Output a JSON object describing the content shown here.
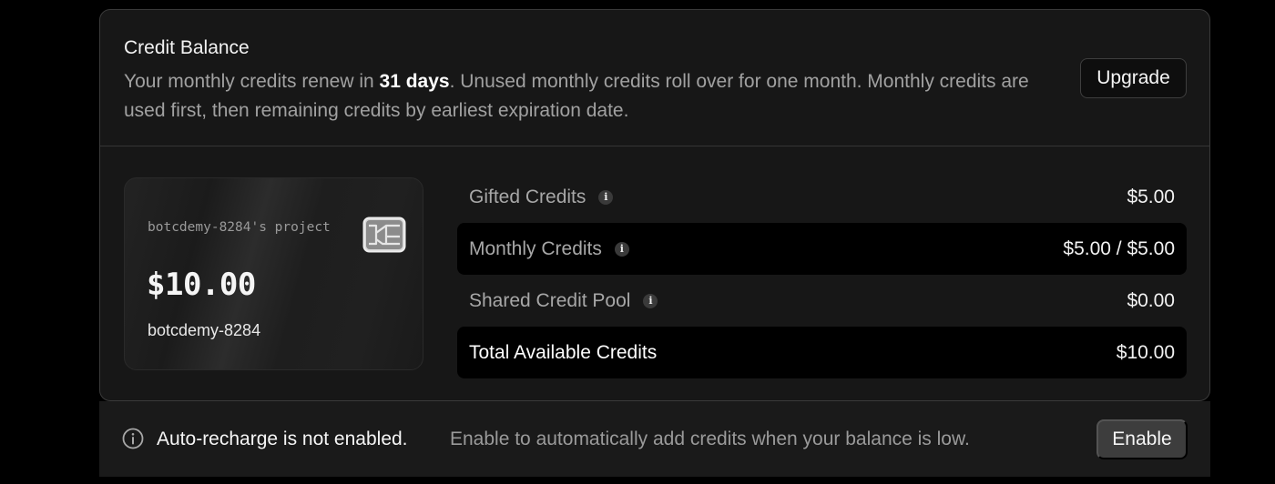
{
  "credit_balance": {
    "title": "Credit Balance",
    "desc_prefix": "Your monthly credits renew in ",
    "desc_days": "31 days",
    "desc_suffix": ". Unused monthly credits roll over for one month. Monthly credits are used first, then remaining credits by earliest expiration date.",
    "upgrade_label": "Upgrade"
  },
  "card": {
    "project": "botcdemy-8284's project",
    "amount": "$10.00",
    "name": "botcdemy-8284",
    "icon": "chip-icon"
  },
  "rows": [
    {
      "label": "Gifted Credits",
      "value": "$5.00",
      "info": true,
      "highlight": false
    },
    {
      "label": "Monthly Credits",
      "value": "$5.00 / $5.00",
      "info": true,
      "highlight": true
    },
    {
      "label": "Shared Credit Pool",
      "value": "$0.00",
      "info": true,
      "highlight": false
    },
    {
      "label": "Total Available Credits",
      "value": "$10.00",
      "info": false,
      "highlight": true
    }
  ],
  "info_glyph": "i",
  "auto_recharge": {
    "status": "Auto-recharge is not enabled.",
    "message": "Enable to automatically add credits when your balance is low.",
    "enable_label": "Enable",
    "icon": "info-circle-icon"
  }
}
